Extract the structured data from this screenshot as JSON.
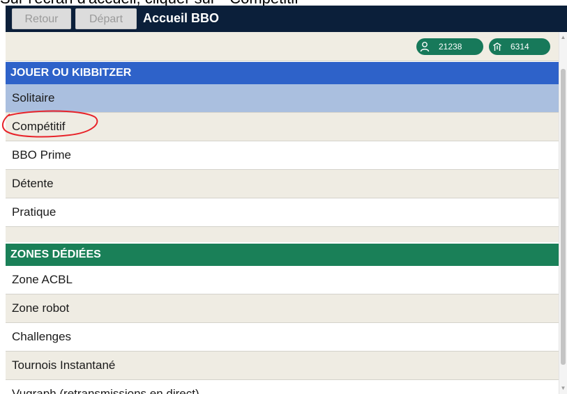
{
  "caption": "Sur l'écran d'accueil, cliquer sur \" Compétitif\"",
  "topbar": {
    "back_label": "Retour",
    "depart_label": "Départ",
    "title": "Accueil BBO"
  },
  "stats": {
    "players_icon": "person-icon",
    "players_count": "21238",
    "tables_icon": "table-icon",
    "tables_count": "6314"
  },
  "sections": {
    "play": {
      "title": "JOUER OU KIBBITZER",
      "items": [
        {
          "label": "Solitaire"
        },
        {
          "label": "Compétitif"
        },
        {
          "label": "BBO Prime"
        },
        {
          "label": "Détente"
        },
        {
          "label": "Pratique"
        }
      ]
    },
    "zones": {
      "title": "ZONES DÉDIÉES",
      "items": [
        {
          "label": "Zone ACBL"
        },
        {
          "label": "Zone robot"
        },
        {
          "label": "Challenges"
        },
        {
          "label": "Tournois Instantané"
        },
        {
          "label": "Vugraph (retransmissions en direct)"
        }
      ]
    }
  },
  "colors": {
    "topbar": "#0b1f3a",
    "play_header": "#2e62c9",
    "zones_header": "#1a8058",
    "selected_row": "#aabfdf",
    "row_beige": "#efece3",
    "pill": "#17795a",
    "annotation": "#e8232a"
  }
}
